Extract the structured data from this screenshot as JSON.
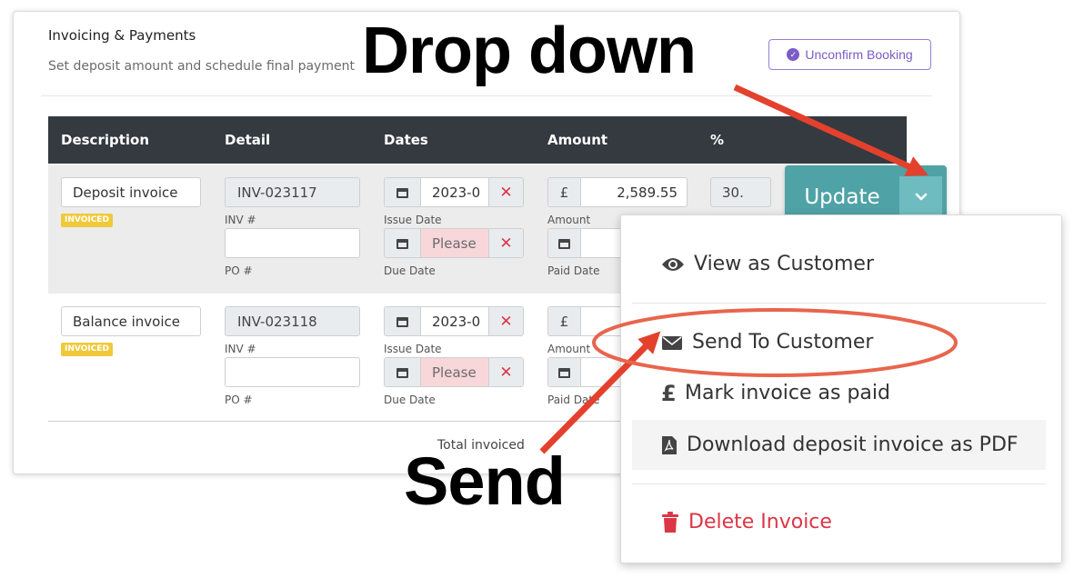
{
  "card": {
    "title": "Invoicing & Payments",
    "subtitle": "Set deposit amount and schedule final payment",
    "unconfirm_label": "Unconfirm Booking"
  },
  "table": {
    "headers": [
      "Description",
      "Detail",
      "Dates",
      "Amount",
      "%"
    ]
  },
  "rows": [
    {
      "description": "Deposit invoice",
      "badge": "INVOICED",
      "inv_number": "INV-023117",
      "inv_label": "INV #",
      "po_value": "",
      "po_label": "PO #",
      "issue_date": "2023-0",
      "issue_label": "Issue Date",
      "due_date": "Please",
      "due_label": "Due Date",
      "currency": "£",
      "amount": "2,589.55",
      "amount_label": "Amount",
      "paid_value": "",
      "paid_label": "Paid Date",
      "percent": "30."
    },
    {
      "description": "Balance invoice",
      "badge": "INVOICED",
      "inv_number": "INV-023118",
      "inv_label": "INV #",
      "po_value": "",
      "po_label": "PO #",
      "issue_date": "2023-0",
      "issue_label": "Issue Date",
      "due_date": "Please",
      "due_label": "Due Date",
      "currency": "£",
      "amount": "",
      "amount_label": "Amount",
      "paid_value": "",
      "paid_label": "Paid Date",
      "percent": ""
    }
  ],
  "total_label": "Total invoiced",
  "update": {
    "label": "Update"
  },
  "dropdown": {
    "items": [
      {
        "label": "View as Customer",
        "icon": "eye-icon"
      },
      {
        "label": "Send To Customer",
        "icon": "envelope-icon"
      },
      {
        "label": "Mark invoice as paid",
        "icon": "pound-icon"
      },
      {
        "label": "Download deposit invoice as PDF",
        "icon": "pdf-file-icon"
      },
      {
        "label": "Delete Invoice",
        "icon": "trash-icon"
      }
    ]
  },
  "annotations": {
    "drop_down": "Drop down",
    "send": "Send"
  },
  "colors": {
    "accent_teal": "#4fa2a6",
    "purple": "#7b5cc8",
    "danger": "#dc3545",
    "badge": "#f0c93b",
    "annotation_red": "#e3412d",
    "ellipse": "#e8654d"
  }
}
